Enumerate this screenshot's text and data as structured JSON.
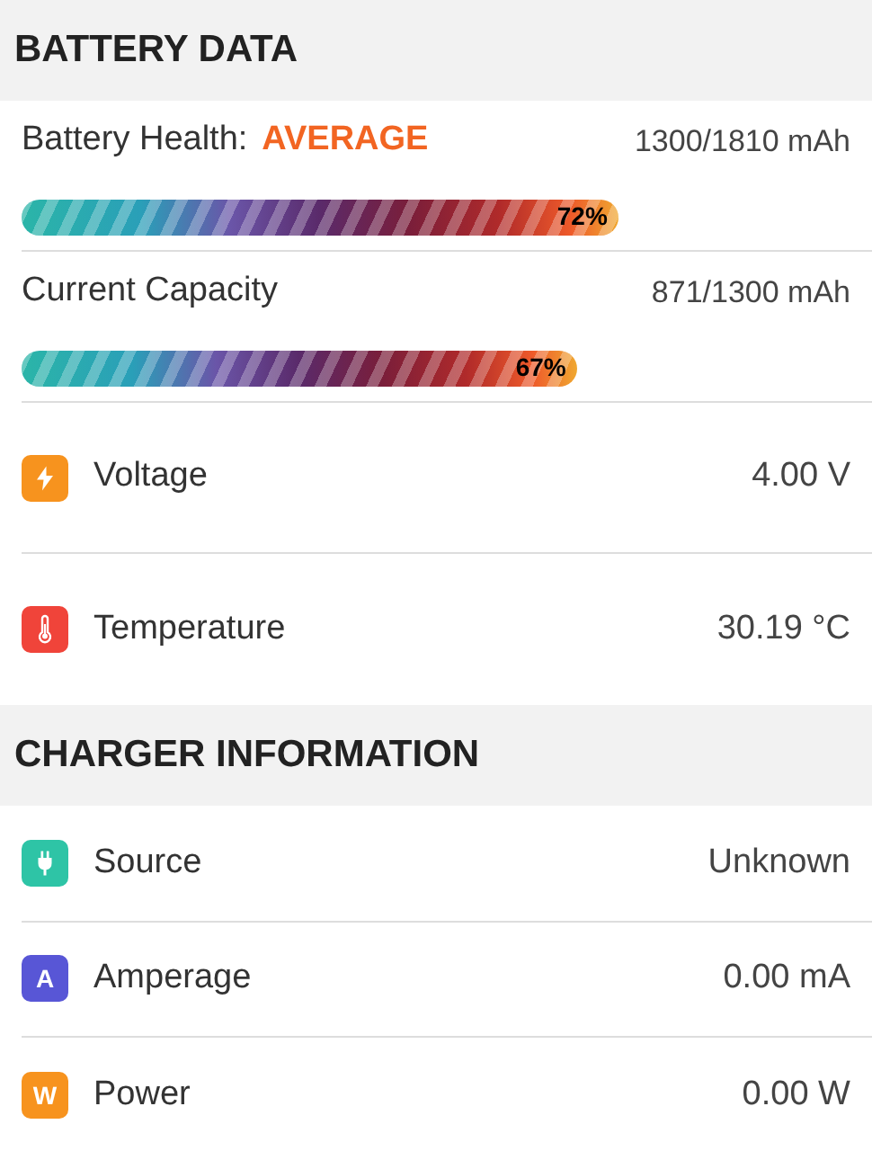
{
  "sections": [
    {
      "title": "BATTERY DATA",
      "rows": [
        {
          "kind": "meter",
          "label": "Battery Health:",
          "status": "AVERAGE",
          "value": "1300/1810 mAh",
          "reading": "72%"
        },
        {
          "kind": "meter",
          "label": "Current Capacity",
          "value": "871/1300 mAh",
          "reading": "67%"
        },
        {
          "kind": "stat",
          "badge": {
            "kind": "bolt",
            "color": "#f7931e"
          },
          "label": "Voltage",
          "value": "4.00 V"
        },
        {
          "kind": "stat",
          "badge": {
            "kind": "thermometer",
            "color": "#f0443a"
          },
          "label": "Temperature",
          "value": "30.19 °C"
        }
      ]
    },
    {
      "title": "CHARGER INFORMATION",
      "rows": [
        {
          "kind": "stat",
          "badge": {
            "kind": "plug",
            "color": "#2ec4a6"
          },
          "label": "Source",
          "value": "Unknown"
        },
        {
          "kind": "stat",
          "badge": {
            "kind": "letter",
            "letter": "A",
            "color": "#5856d6"
          },
          "label": "Amperage",
          "value": "0.00 mA"
        },
        {
          "kind": "stat",
          "badge": {
            "kind": "letter",
            "letter": "W",
            "color": "#f7931e"
          },
          "label": "Power",
          "value": "0.00 W"
        }
      ]
    }
  ]
}
